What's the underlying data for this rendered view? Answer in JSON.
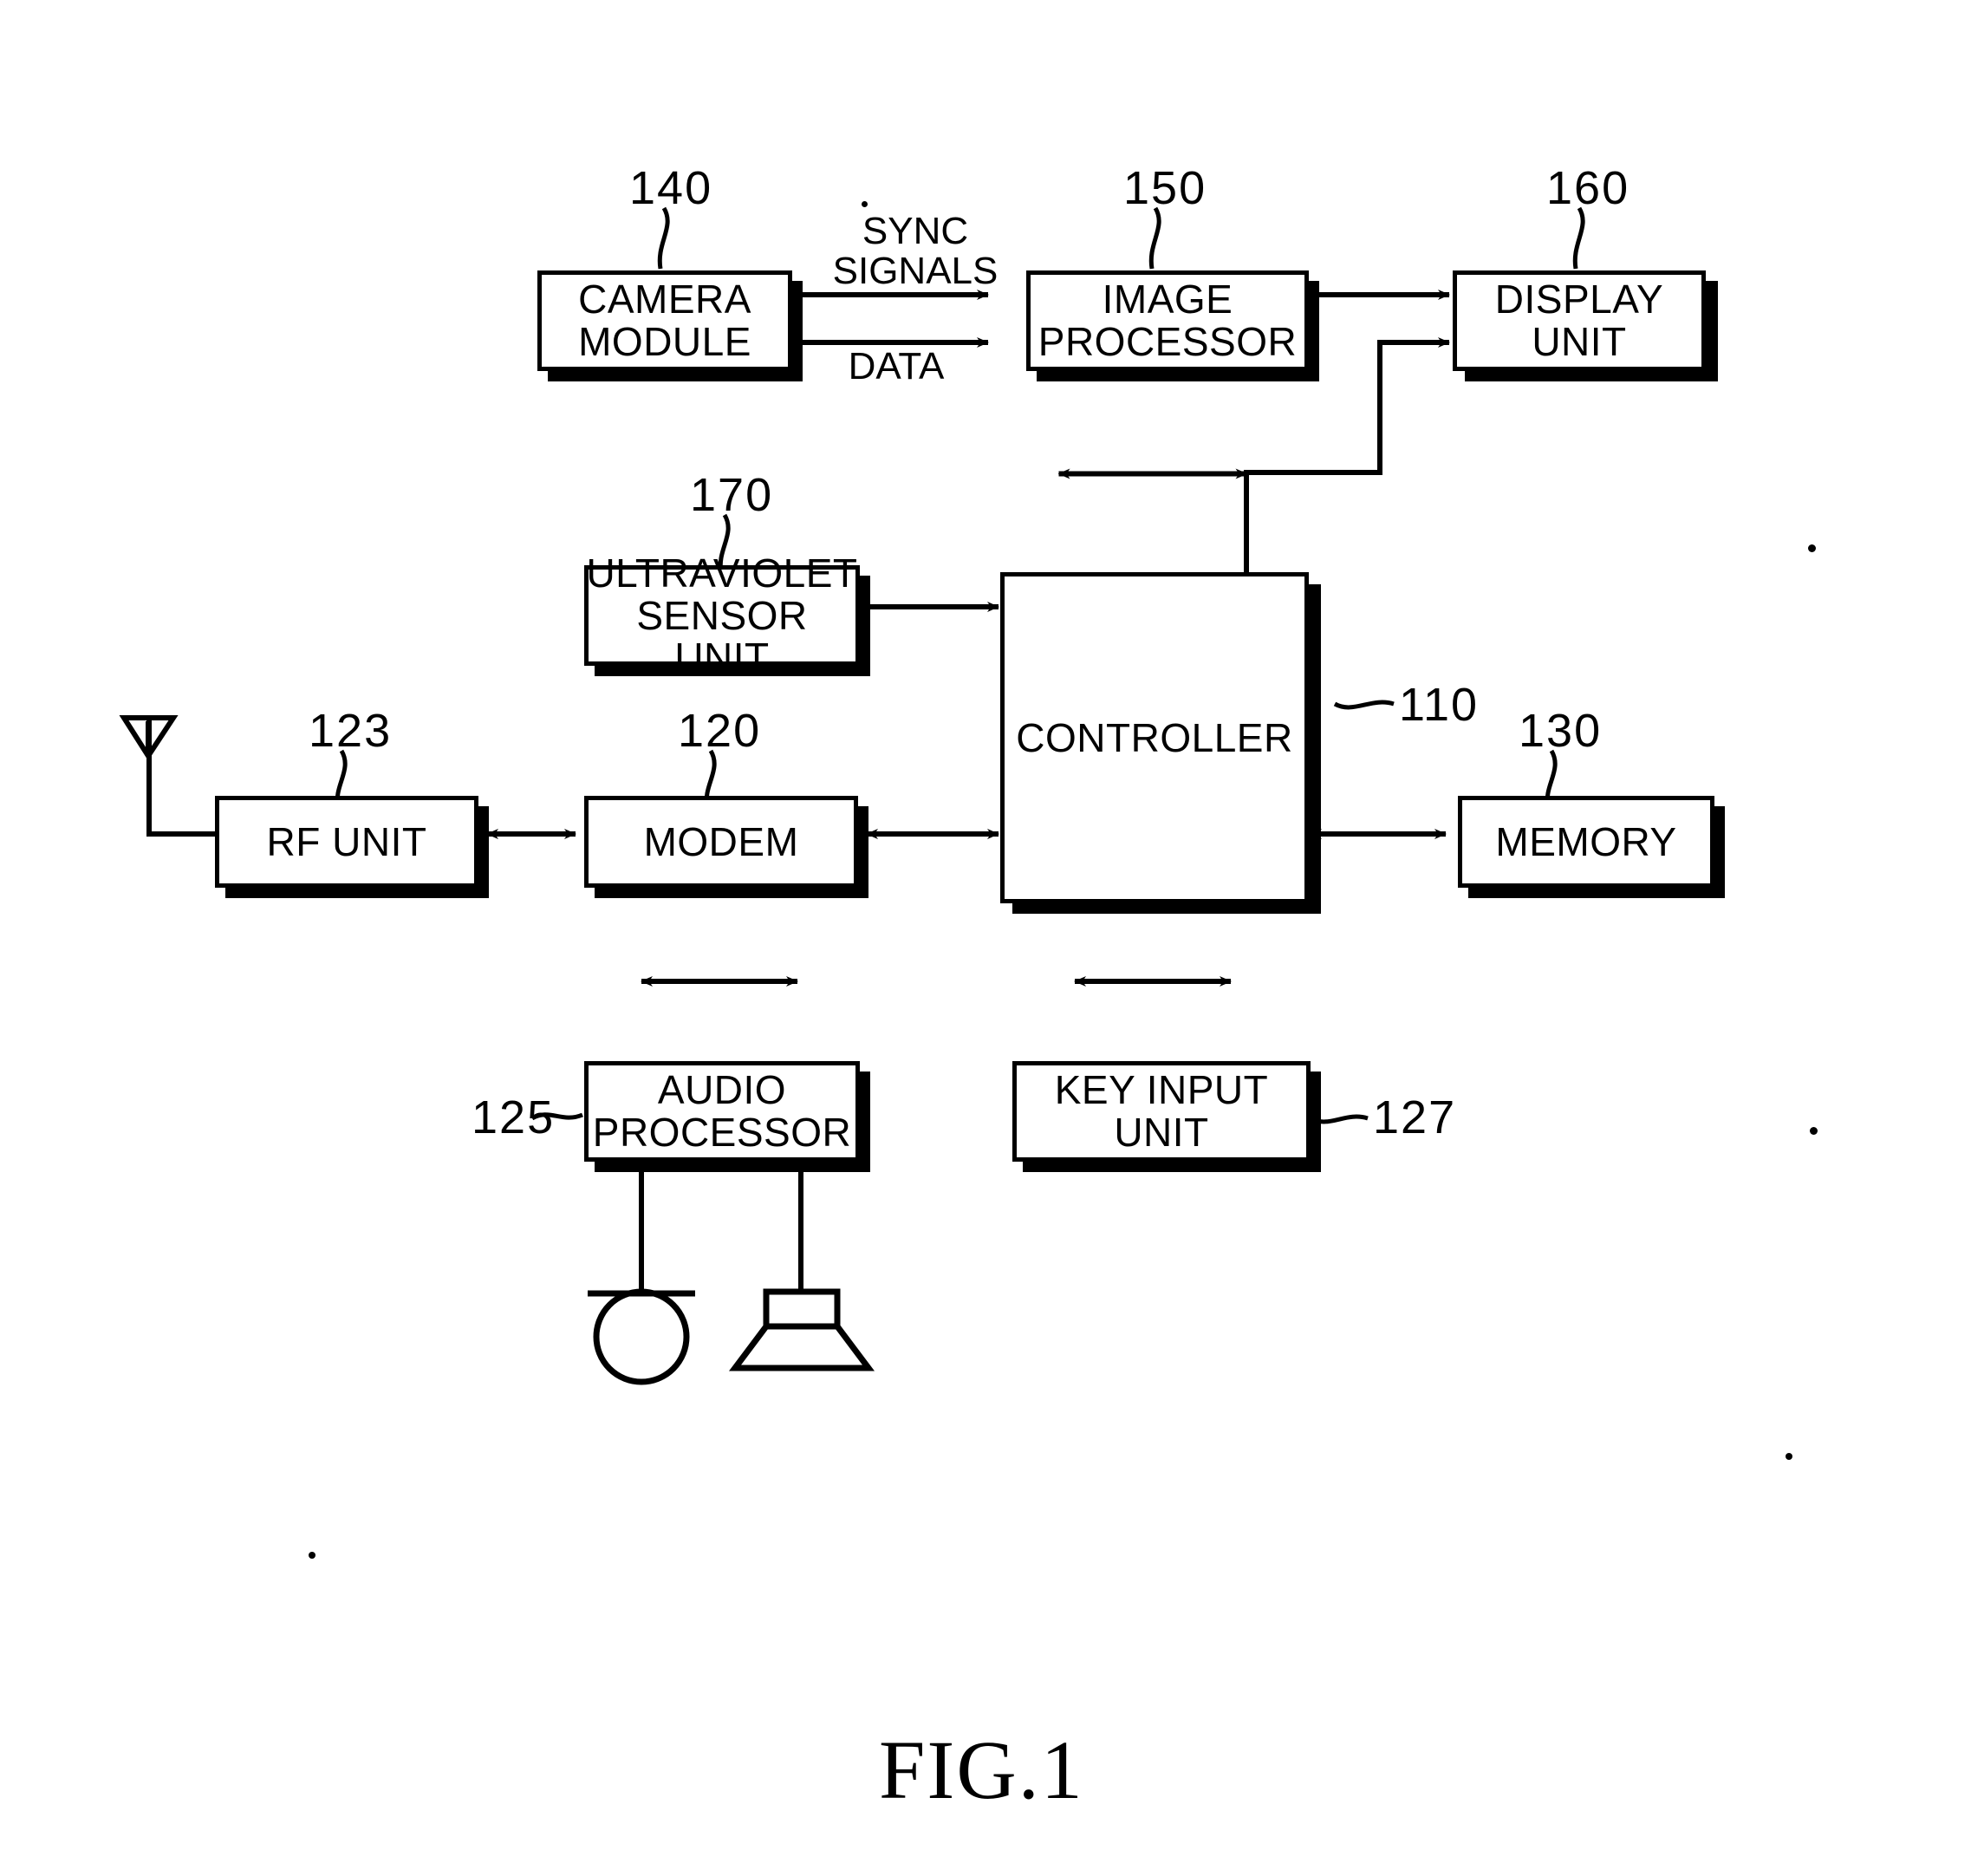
{
  "figure": {
    "caption": "FIG.1",
    "type": "patent-block-diagram"
  },
  "blocks": {
    "camera_module": {
      "label": "CAMERA\nMODULE",
      "ref": "140"
    },
    "image_processor": {
      "label": "IMAGE\nPROCESSOR",
      "ref": "150"
    },
    "display_unit": {
      "label": "DISPLAY\nUNIT",
      "ref": "160"
    },
    "ultraviolet_sensor_unit": {
      "label": "ULTRAVIOLET\nSENSOR UNIT",
      "ref": "170"
    },
    "controller": {
      "label": "CONTROLLER",
      "ref": "110"
    },
    "memory": {
      "label": "MEMORY",
      "ref": "130"
    },
    "rf_unit": {
      "label": "RF UNIT",
      "ref": "123"
    },
    "modem": {
      "label": "MODEM",
      "ref": "120"
    },
    "audio_processor": {
      "label": "AUDIO\nPROCESSOR",
      "ref": "125"
    },
    "key_input_unit": {
      "label": "KEY INPUT\nUNIT",
      "ref": "127"
    }
  },
  "edge_labels": {
    "sync_signals": "SYNC\nSIGNALS",
    "data": "DATA"
  },
  "symbols": {
    "antenna": "antenna-icon",
    "microphone": "microphone-icon",
    "speaker": "speaker-icon"
  },
  "colors": {
    "ink": "#000000",
    "paper": "#ffffff"
  }
}
